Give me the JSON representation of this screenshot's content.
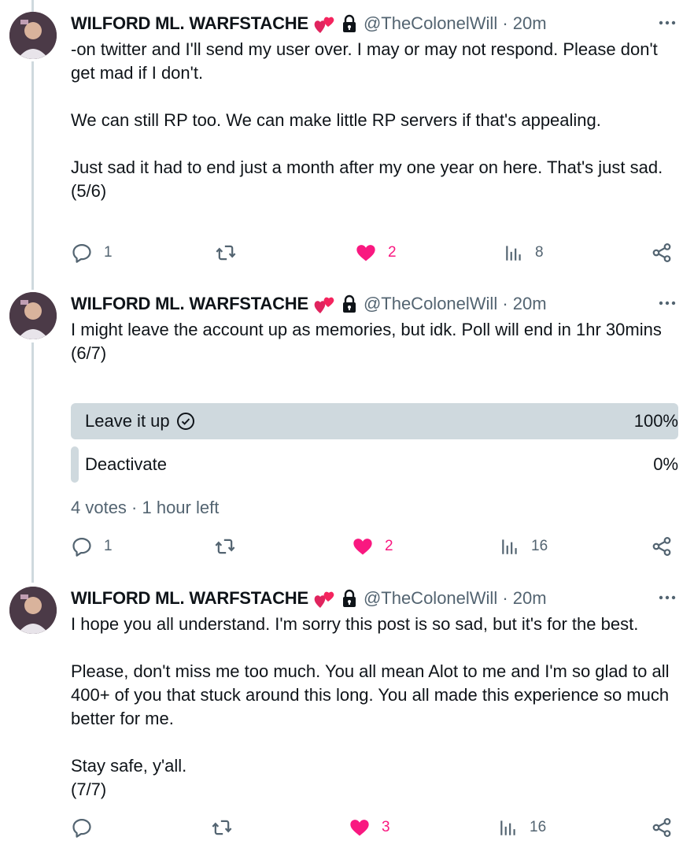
{
  "author": {
    "display_name": "WILFORD ML. WARFSTACHE",
    "handle_time": "@TheColonelWill · 20m"
  },
  "colors": {
    "like": "#f91880",
    "muted": "#536471",
    "text": "#0f1419",
    "poll_bar": "#cfd9de"
  },
  "icons": [
    "hearts-emoji-icon",
    "lock-icon",
    "more-icon",
    "reply-icon",
    "retweet-icon",
    "like-icon",
    "views-icon",
    "share-icon",
    "check-circle-icon"
  ],
  "tweets": [
    {
      "paragraphs": [
        "-on twitter and I'll send my user over. I may or may not respond. Please don't get mad if I don't.",
        "We can still RP too. We can make little RP servers if that's appealing.",
        "Just sad it had to end just a month after my one year on here. That's just sad.",
        "(5/6)"
      ],
      "replies": "1",
      "retweets": "",
      "likes": "2",
      "views": "8"
    },
    {
      "paragraphs": [
        "I might leave the account up as memories, but idk. Poll will end in 1hr 30mins",
        "(6/7)"
      ],
      "poll": {
        "options": [
          {
            "label": "Leave it up",
            "percent_text": "100%",
            "fraction": 1.0,
            "winner": true
          },
          {
            "label": "Deactivate",
            "percent_text": "0%",
            "fraction": 0.0,
            "winner": false
          }
        ],
        "meta": "4 votes · 1 hour left"
      },
      "replies": "1",
      "retweets": "",
      "likes": "2",
      "views": "16"
    },
    {
      "paragraphs": [
        "I hope you all understand. I'm sorry this post is so sad, but it's for the best.",
        "Please, don't miss me too much. You all mean Alot to me and I'm so glad to all 400+ of you that stuck around this long. You all made this experience so much better for me.",
        "Stay safe, y'all.",
        "(7/7)"
      ],
      "replies": "",
      "retweets": "",
      "likes": "3",
      "views": "16"
    }
  ]
}
